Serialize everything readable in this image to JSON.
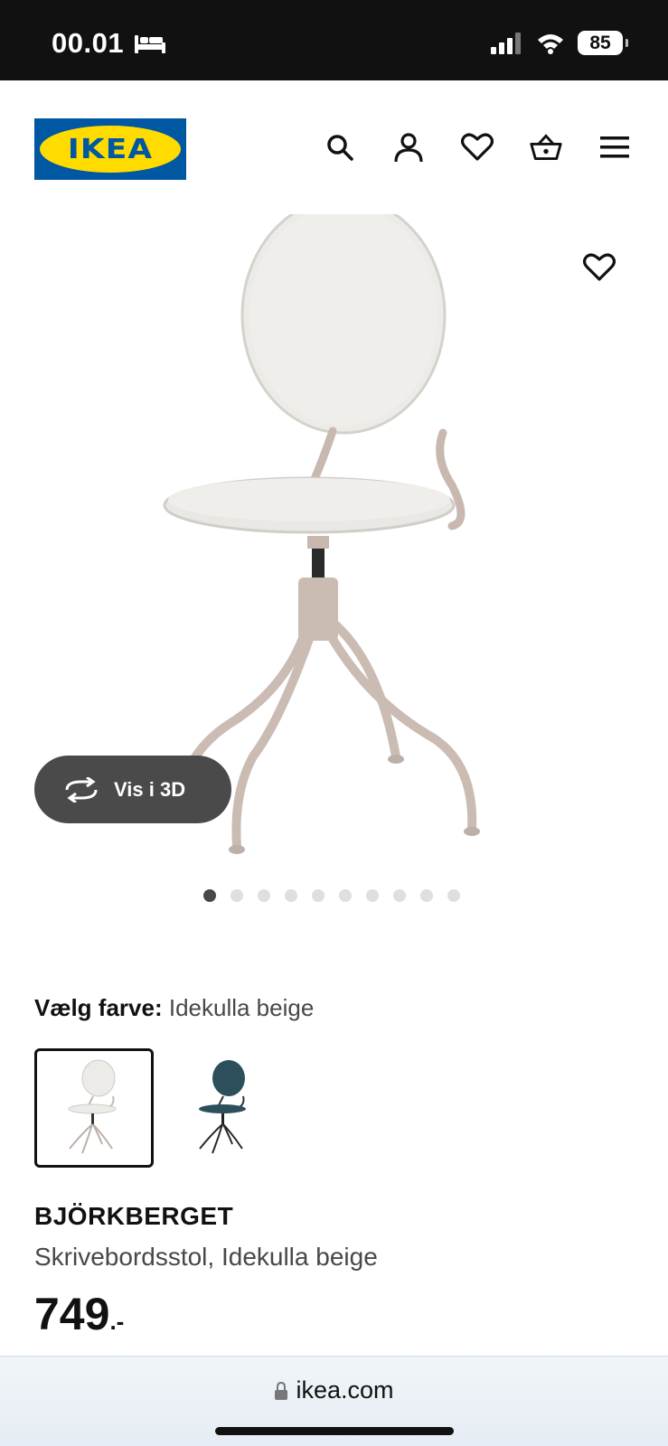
{
  "status_bar": {
    "time": "00.01",
    "battery": "85"
  },
  "header": {
    "logo_text": "IKEA",
    "icons": [
      "search-icon",
      "account-icon",
      "favorites-heart-icon",
      "basket-icon",
      "menu-icon"
    ]
  },
  "gallery": {
    "view_3d_label": "Vis i 3D",
    "image_count": 10,
    "active_index": 0
  },
  "color": {
    "label": "Vælg farve:",
    "value": "Idekulla beige",
    "options": [
      "Idekulla beige",
      "blue"
    ]
  },
  "product": {
    "name": "BJÖRKBERGET",
    "description": "Skrivebordsstol, Idekulla beige",
    "price": "749",
    "price_suffix": ".-"
  },
  "browser": {
    "url": "ikea.com"
  },
  "colors": {
    "ikea_blue": "#0058a3",
    "ikea_yellow": "#ffdb00",
    "status_bar": "#111111"
  }
}
